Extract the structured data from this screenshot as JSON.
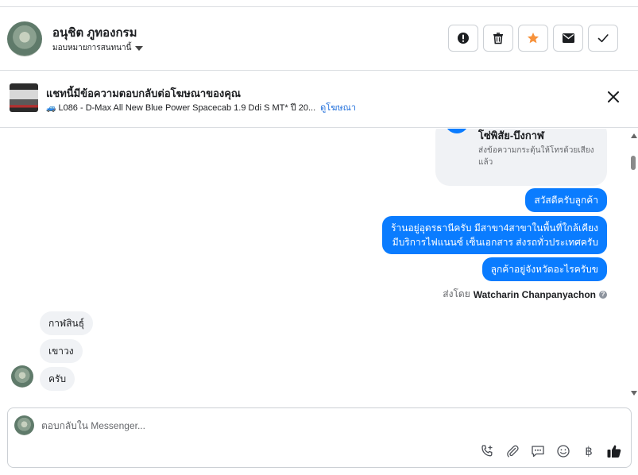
{
  "header": {
    "contact_name": "อนุชิต ภูทองกรม",
    "assign_label": "มอบหมายการสนทนานี้",
    "actions": [
      {
        "name": "report-button",
        "icon": "alert-icon"
      },
      {
        "name": "delete-button",
        "icon": "trash-icon"
      },
      {
        "name": "star-button",
        "icon": "star-icon"
      },
      {
        "name": "mark-unread-button",
        "icon": "envelope-icon"
      },
      {
        "name": "mark-done-button",
        "icon": "check-icon"
      }
    ],
    "star_color": "#f7923b"
  },
  "ad_banner": {
    "title": "แชทนี้มีข้อความตอบกลับต่อโฆษณาของคุณ",
    "ad_text": "L086 - D-Max All New Blue Power Spacecab 1.9 Ddi S MT* ปี 20...",
    "view_ad_link": "ดูโฆษณา"
  },
  "conversation": {
    "card": {
      "title": "โชคคูณโชค สาขา โซ่พิสัย-บึงกาฬ",
      "text": "ส่งข้อความกระตุ้นให้โทรด้วยเสียงแล้ว"
    },
    "outgoing": [
      {
        "lines": [
          "สวัสดีครับลูกค้า"
        ]
      },
      {
        "lines": [
          "ร้านอยู่อุดรธานีครับ มีสาขา4สาขาในพื้นที่ใกล้เคียง",
          "มีบริการไฟแนนซ์ เซ็นเอกสาร ส่งรถทั่วประเทศครับ"
        ]
      },
      {
        "lines": [
          "ลูกค้าอยู่จังหวัดอะไรครับข"
        ]
      }
    ],
    "sent_by_prefix": "ส่งโดย",
    "sent_by_name": "Watcharin Chanpanyachon",
    "incoming": [
      "กาฬสินธุ์",
      "เขาวง",
      "ครับ"
    ]
  },
  "composer": {
    "placeholder": "ตอบกลับใน Messenger...",
    "tools": [
      "call-add-icon",
      "attachment-icon",
      "saved-reply-icon",
      "emoji-icon",
      "baht-icon",
      "like-icon"
    ]
  },
  "colors": {
    "accent": "#0a7cff",
    "link": "#216fdb",
    "incoming_bubble": "#f0f2f5"
  }
}
